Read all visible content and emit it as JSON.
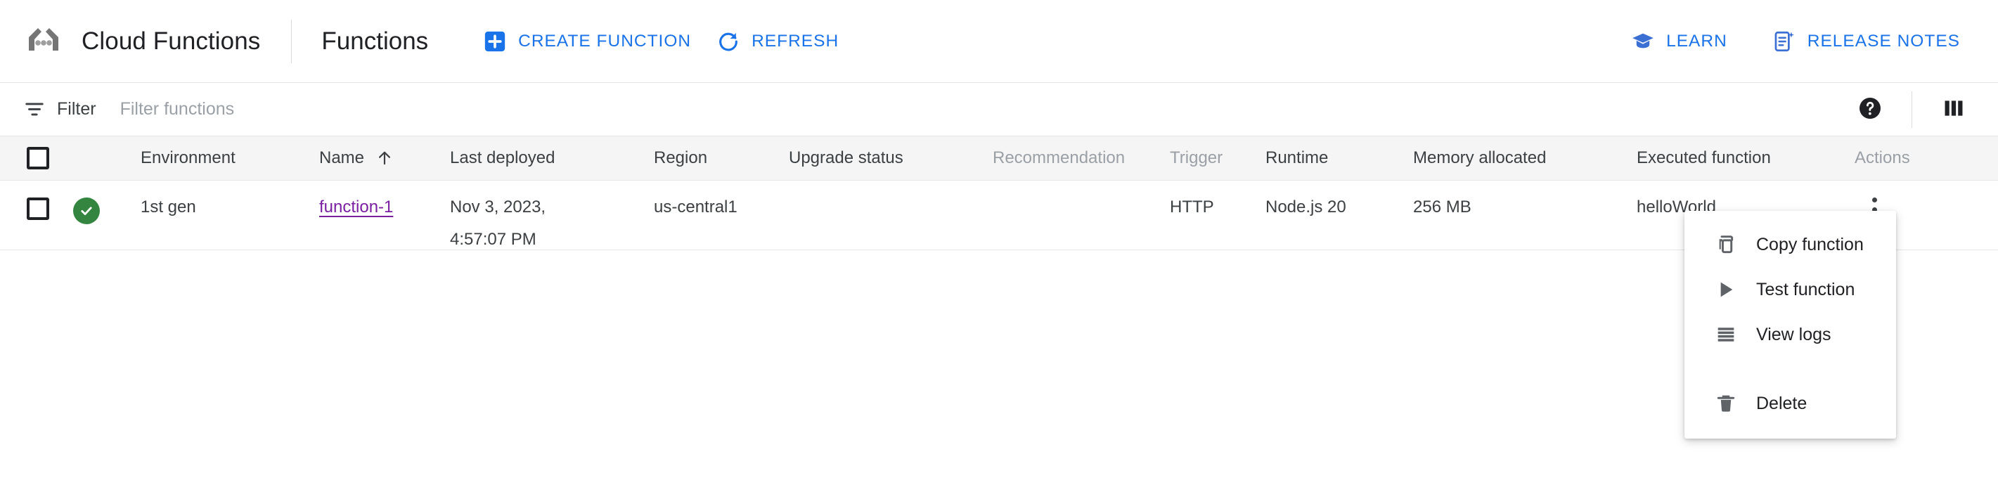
{
  "header": {
    "logo_icon": "cloud-functions-logo-icon",
    "product_title": "Cloud Functions",
    "page_heading": "Functions",
    "actions": [
      {
        "id": "create-function",
        "label": "CREATE FUNCTION",
        "icon": "plus-square-icon"
      },
      {
        "id": "refresh",
        "label": "REFRESH",
        "icon": "refresh-icon"
      }
    ],
    "right_actions": [
      {
        "id": "learn",
        "label": "LEARN",
        "icon": "graduation-cap-icon"
      },
      {
        "id": "release-notes",
        "label": "RELEASE NOTES",
        "icon": "release-notes-icon"
      }
    ]
  },
  "filter_bar": {
    "icon": "filter-icon",
    "label": "Filter",
    "placeholder": "Filter functions",
    "value": "",
    "help_icon": "help-circle-icon",
    "columns_icon": "column-settings-icon"
  },
  "table": {
    "columns": [
      {
        "id": "select",
        "label": "",
        "muted": false
      },
      {
        "id": "status",
        "label": "",
        "muted": false
      },
      {
        "id": "environment",
        "label": "Environment",
        "muted": false
      },
      {
        "id": "name",
        "label": "Name",
        "muted": false,
        "sorted": "asc",
        "sort_icon": "arrow-up-icon"
      },
      {
        "id": "last_deployed",
        "label": "Last deployed",
        "muted": false
      },
      {
        "id": "region",
        "label": "Region",
        "muted": false
      },
      {
        "id": "upgrade_status",
        "label": "Upgrade status",
        "muted": false
      },
      {
        "id": "recommendation",
        "label": "Recommendation",
        "muted": true
      },
      {
        "id": "trigger",
        "label": "Trigger",
        "muted": true
      },
      {
        "id": "runtime",
        "label": "Runtime",
        "muted": false
      },
      {
        "id": "memory",
        "label": "Memory allocated",
        "muted": false
      },
      {
        "id": "executed",
        "label": "Executed function",
        "muted": false
      },
      {
        "id": "actions",
        "label": "Actions",
        "muted": true
      }
    ],
    "rows": [
      {
        "selected": false,
        "status_icon": "check-circle-icon",
        "status_color": "#34853f",
        "environment": "1st gen",
        "name": "function-1",
        "last_deployed_line1": "Nov 3, 2023,",
        "last_deployed_line2": "4:57:07 PM",
        "region": "us-central1",
        "upgrade_status": "",
        "recommendation": "",
        "trigger": "HTTP",
        "runtime": "Node.js 20",
        "memory_allocated": "256 MB",
        "executed_function": "helloWorld",
        "actions_icon": "more-vert-icon"
      }
    ]
  },
  "context_menu": {
    "items": [
      {
        "id": "copy-function",
        "label": "Copy function",
        "icon": "copy-icon"
      },
      {
        "id": "test-function",
        "label": "Test function",
        "icon": "play-icon"
      },
      {
        "id": "view-logs",
        "label": "View logs",
        "icon": "logs-icon"
      },
      {
        "id": "delete",
        "label": "Delete",
        "icon": "trash-icon"
      }
    ]
  },
  "colors": {
    "accent_blue": "#1a73e8",
    "link_purple": "#7b1fa2",
    "status_green": "#34853f",
    "header_row_bg": "#f5f5f5",
    "text_primary": "#202124",
    "text_secondary": "#3c4043",
    "text_muted": "#9aa0a6"
  }
}
